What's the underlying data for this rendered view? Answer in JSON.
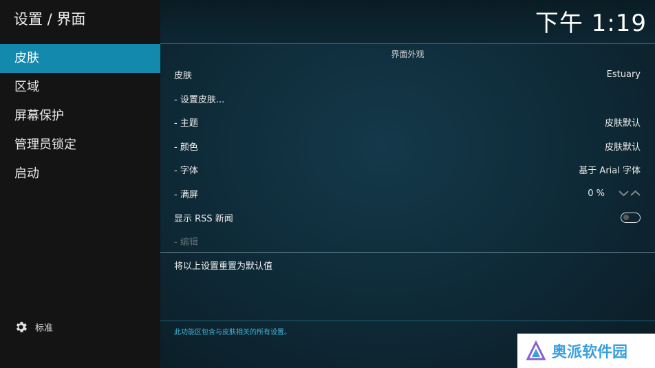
{
  "header": {
    "title": "设置 / 界面"
  },
  "clock": "下午 1:19",
  "sidebar": {
    "items": [
      {
        "label": "皮肤",
        "active": true
      },
      {
        "label": "区域",
        "active": false
      },
      {
        "label": "屏幕保护",
        "active": false
      },
      {
        "label": "管理员锁定",
        "active": false
      },
      {
        "label": "启动",
        "active": false
      }
    ],
    "level_label": "标准"
  },
  "main": {
    "section_title": "界面外观",
    "settings": [
      {
        "label": "皮肤",
        "value": "Estuary"
      },
      {
        "label": "- 设置皮肤...",
        "value": ""
      },
      {
        "label": "- 主题",
        "value": "皮肤默认"
      },
      {
        "label": "- 颜色",
        "value": "皮肤默认"
      },
      {
        "label": "- 字体",
        "value": "基于 Arial 字体"
      },
      {
        "label": "- 满屏",
        "value": "0 %"
      },
      {
        "label": "显示 RSS 新闻",
        "value": ""
      },
      {
        "label": "- 编辑",
        "value": ""
      }
    ],
    "rss_toggle_on": false,
    "reset_label": "将以上设置重置为默认值",
    "help_text": "此功能区包含与皮肤相关的所有设置。"
  },
  "watermark": {
    "text": "奥派软件园"
  },
  "colors": {
    "accent": "#1289ad",
    "help": "#3fb1d3"
  }
}
